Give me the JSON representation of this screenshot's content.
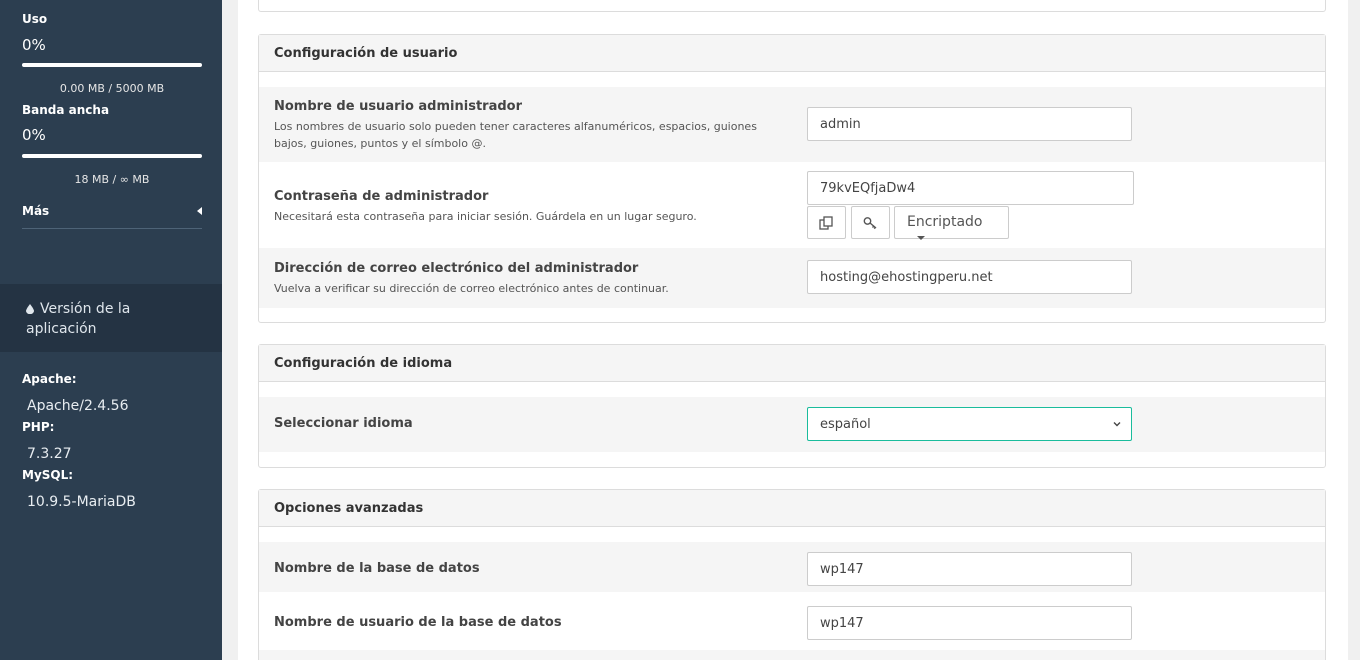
{
  "sidebar": {
    "usage": {
      "label": "Uso",
      "percent_text": "0%",
      "progress": 0,
      "caption": "0.00 MB / 5000 MB"
    },
    "bandwidth": {
      "label": "Banda ancha",
      "percent_text": "0%",
      "progress": 0,
      "caption": "18 MB / ∞ MB"
    },
    "more_label": "Más",
    "version_label": "Versión de la aplicación",
    "apache_label": "Apache:",
    "apache_value": "Apache/2.4.56",
    "php_label": "PHP:",
    "php_value": "7.3.27",
    "mysql_label": "MySQL:",
    "mysql_value": "10.9.5-MariaDB"
  },
  "user_config": {
    "title": "Configuración de usuario",
    "admin_user": {
      "label": "Nombre de usuario administrador",
      "desc": "Los nombres de usuario solo pueden tener caracteres alfanuméricos, espacios, guiones bajos, guiones, puntos y el símbolo @.",
      "value": "admin"
    },
    "admin_pass": {
      "label": "Contraseña de administrador",
      "desc": "Necesitará esta contraseña para iniciar sesión. Guárdela en un lugar seguro.",
      "value": "79kvEQfjaDw4",
      "encrypt_label": "Encriptado"
    },
    "admin_email": {
      "label": "Dirección de correo electrónico del administrador",
      "desc": "Vuelva a verificar su dirección de correo electrónico antes de continuar.",
      "value": "hosting@ehostingperu.net"
    }
  },
  "language_config": {
    "title": "Configuración de idioma",
    "select_label": "Seleccionar idioma",
    "selected": "español"
  },
  "advanced": {
    "title": "Opciones avanzadas",
    "db_name_label": "Nombre de la base de datos",
    "db_name_value": "wp147",
    "db_user_label": "Nombre de usuario de la base de datos",
    "db_user_value": "wp147"
  },
  "colors": {
    "sidebar": "#2c3e50",
    "accent": "#1abc9c"
  }
}
